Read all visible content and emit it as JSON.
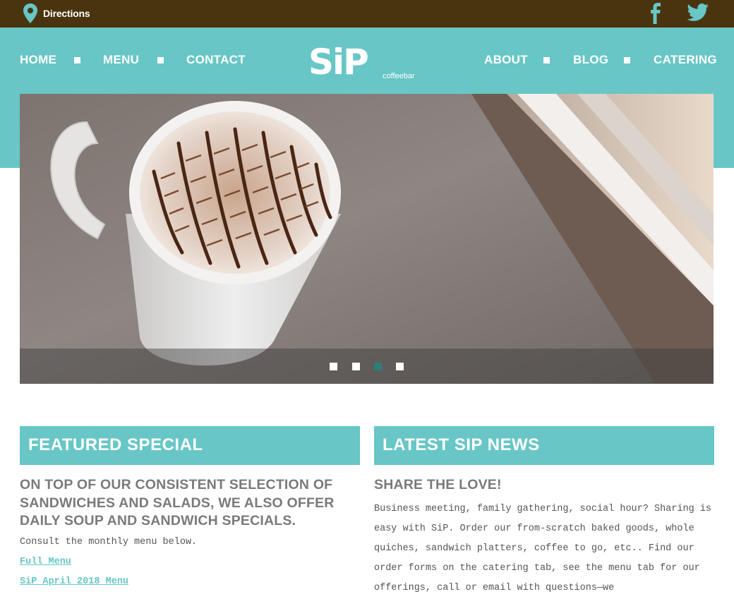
{
  "topbar": {
    "directions_label": "Directions",
    "facebook_label": "f"
  },
  "nav": {
    "left": [
      "HOME",
      "MENU",
      "CONTACT"
    ],
    "right": [
      "ABOUT",
      "BLOG",
      "CATERING"
    ]
  },
  "logo": {
    "wordmark": "SiP",
    "tagline": "coffeebar"
  },
  "slider": {
    "slide_count": 4,
    "active_index": 2
  },
  "featured": {
    "heading": "FEATURED SPECIAL",
    "subheading": "ON TOP OF OUR CONSISTENT SELECTION OF SANDWICHES AND SALADS, WE ALSO OFFER DAILY SOUP AND SANDWICH SPECIALS.",
    "body": "Consult the monthly menu below.",
    "links": [
      "Full Menu",
      "SiP April 2018 Menu"
    ]
  },
  "news": {
    "heading": "LATEST SIP NEWS",
    "subheading": "SHARE THE LOVE!",
    "body": "Business meeting, family gathering, social hour? Sharing is easy with SiP. Order our from-scratch baked goods, whole quiches, sandwich platters, coffee to go, etc.. Find our order forms on the catering tab, see the menu tab for our offerings, call or email with questions—we"
  },
  "colors": {
    "topbar": "#4a3410",
    "accent": "#68c6c6",
    "active_dot": "#2e7d7d",
    "heading_gray": "#7a7a7a"
  },
  "icons": [
    "map-pin-icon",
    "facebook-icon",
    "twitter-icon"
  ]
}
